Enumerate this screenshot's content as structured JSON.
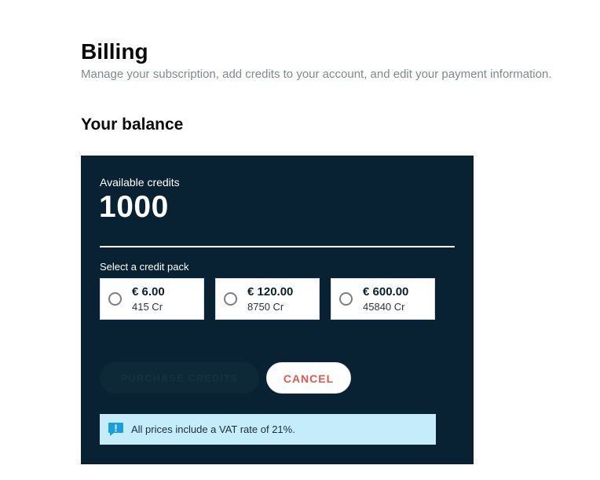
{
  "header": {
    "title": "Billing",
    "subtitle": "Manage your subscription, add credits to your account, and edit your payment information."
  },
  "balance_section": {
    "title": "Your balance",
    "available_label": "Available credits",
    "available_value": "1000",
    "pack_label": "Select a credit pack",
    "packs": [
      {
        "price": "€ 6.00",
        "credits": "415 Cr",
        "selected": false
      },
      {
        "price": "€ 120.00",
        "credits": "8750 Cr",
        "selected": false
      },
      {
        "price": "€ 600.00",
        "credits": "45840 Cr",
        "selected": false
      }
    ],
    "purchase_label": "PURCHASE CREDITS",
    "purchase_enabled": false,
    "cancel_label": "CANCEL",
    "vat_notice": "All prices include a VAT rate of 21%.",
    "vat_icon": "info-icon"
  },
  "colors": {
    "card_background": "#082233",
    "cancel_text": "#e0584f",
    "notice_background": "#c4ecfb",
    "notice_icon": "#1a9ee0"
  }
}
